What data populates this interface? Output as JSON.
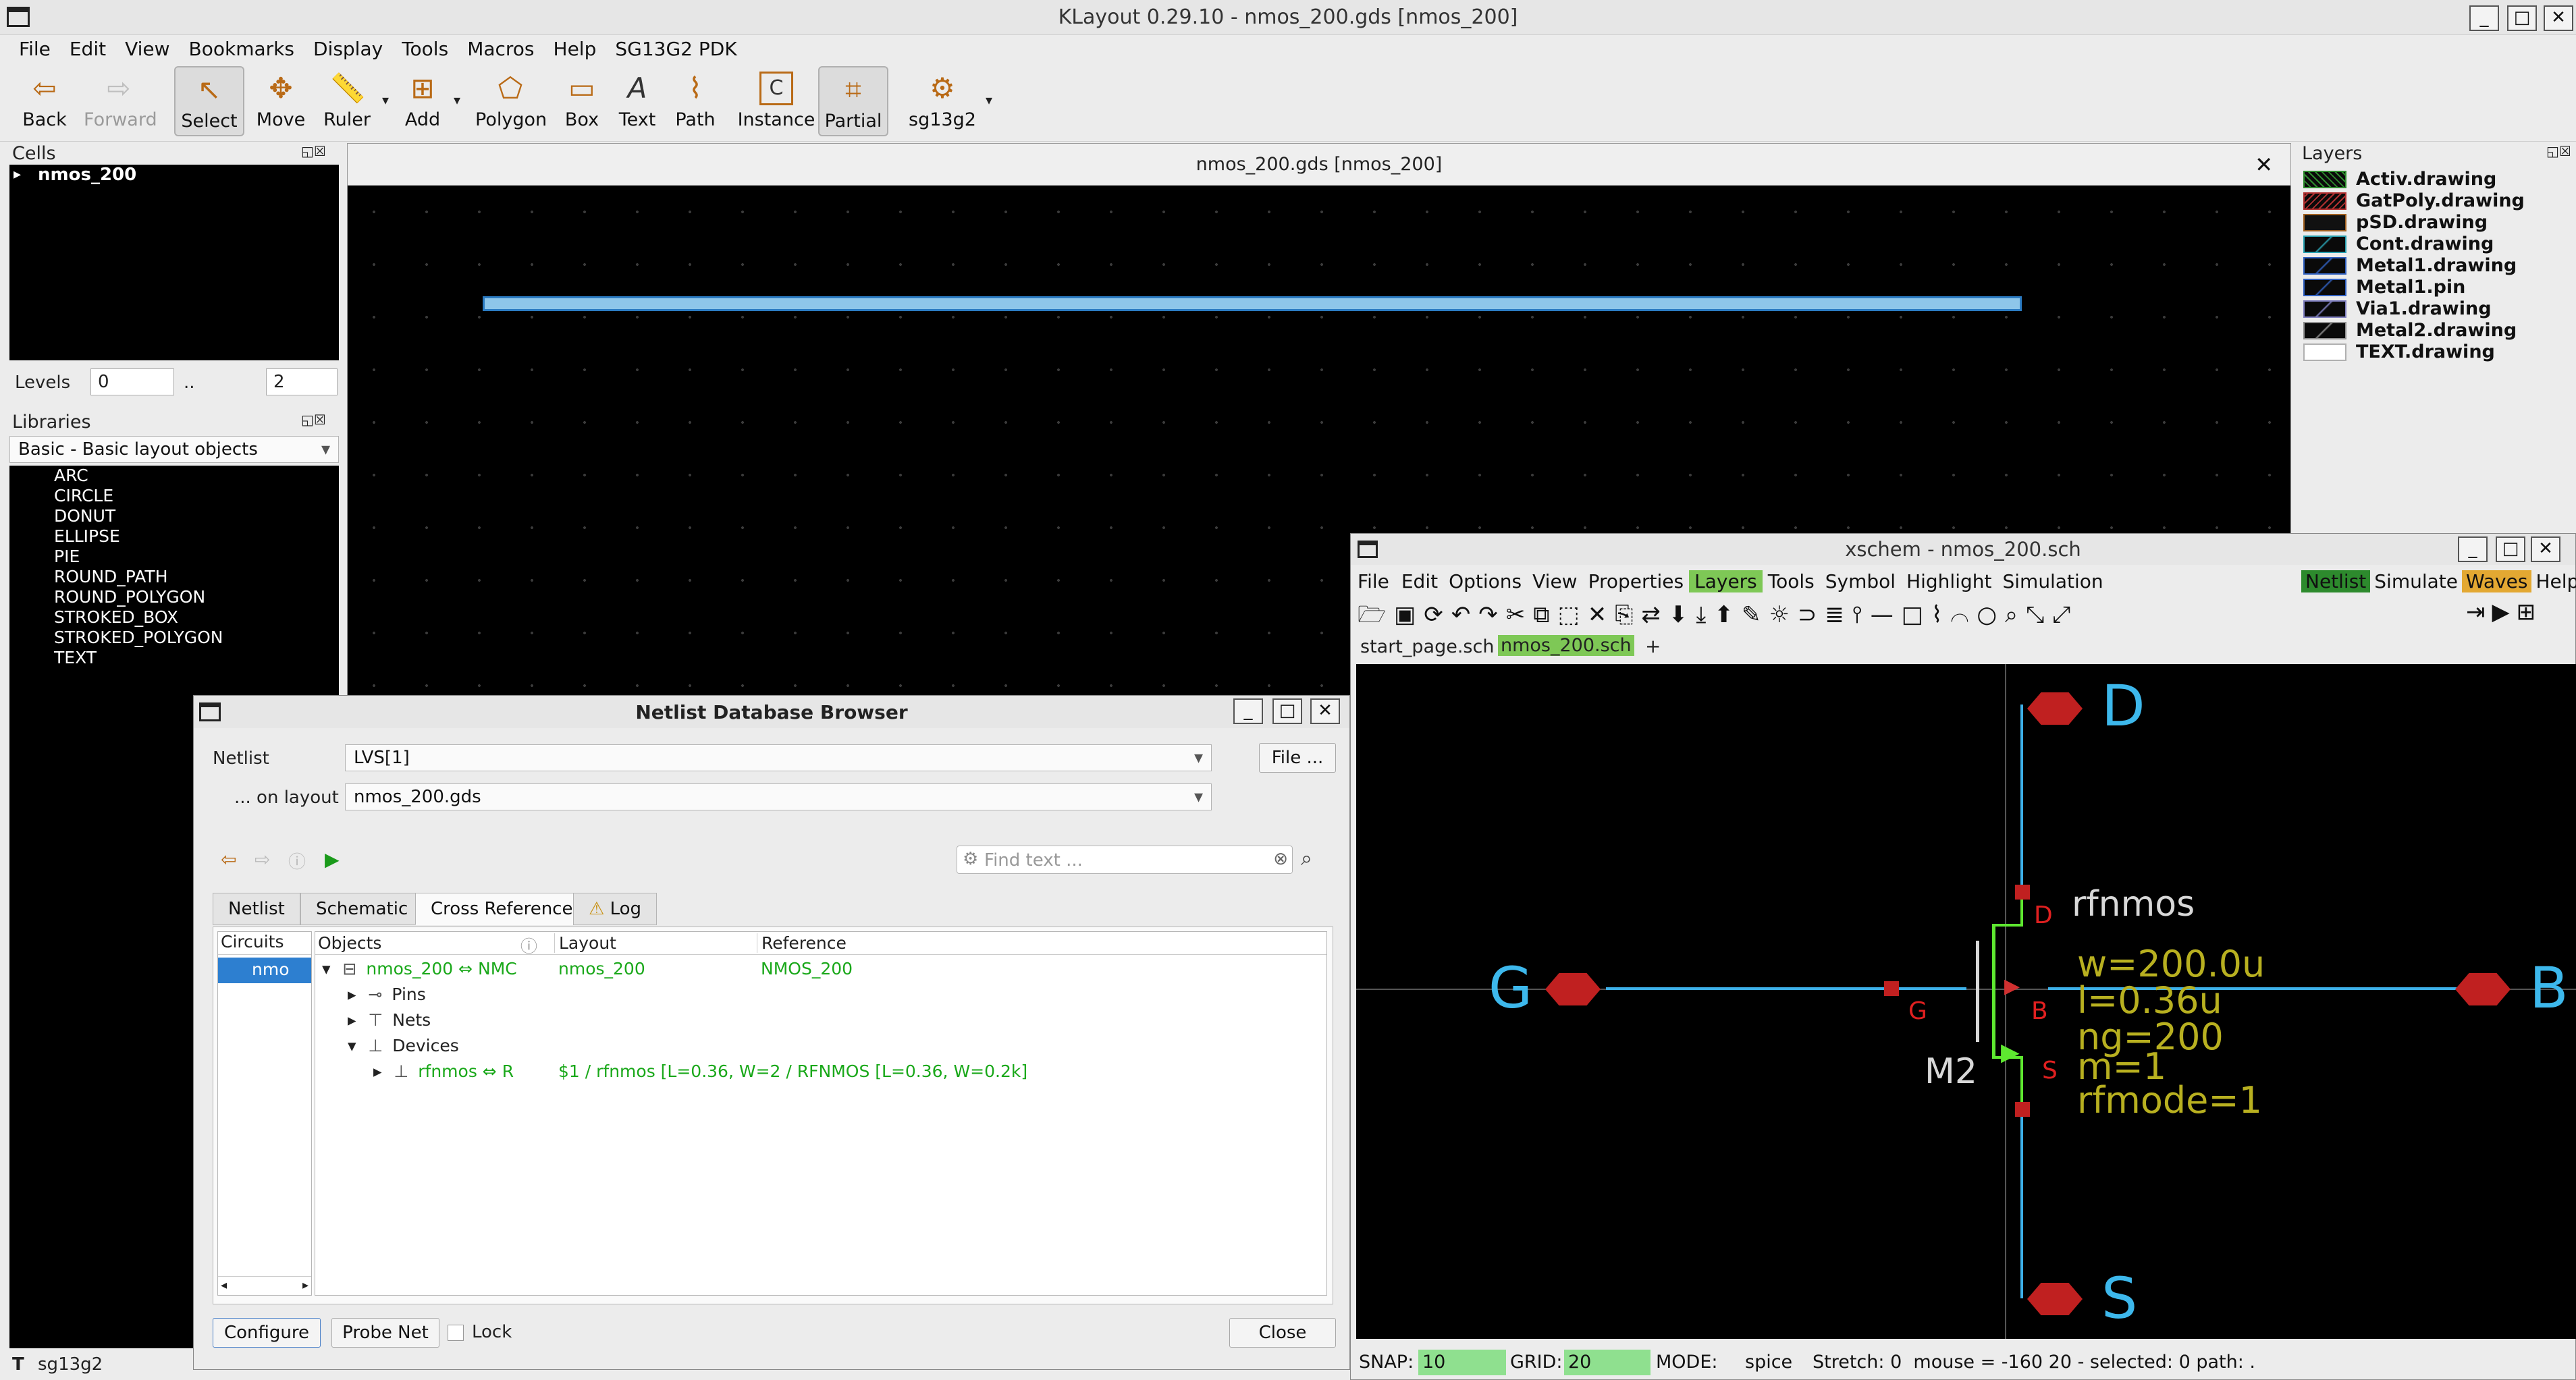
{
  "window": {
    "title": "KLayout 0.29.10 - nmos_200.gds [nmos_200]"
  },
  "menu": [
    "File",
    "Edit",
    "View",
    "Bookmarks",
    "Display",
    "Tools",
    "Macros",
    "Help",
    "SG13G2 PDK"
  ],
  "toolbar": {
    "back": "Back",
    "forward": "Forward",
    "select": "Select",
    "move": "Move",
    "ruler": "Ruler",
    "add": "Add",
    "polygon": "Polygon",
    "box": "Box",
    "text": "Text",
    "path": "Path",
    "instance": "Instance",
    "partial": "Partial",
    "pdk": "sg13g2"
  },
  "cells": {
    "title": "Cells",
    "root": "nmos_200"
  },
  "levels": {
    "label": "Levels",
    "from": "0",
    "sep": "..",
    "to": "2"
  },
  "libraries": {
    "title": "Libraries",
    "selected": "Basic - Basic layout objects",
    "items": [
      "ARC",
      "CIRCLE",
      "DONUT",
      "ELLIPSE",
      "PIE",
      "ROUND_PATH",
      "ROUND_POLYGON",
      "STROKED_BOX",
      "STROKED_POLYGON",
      "TEXT"
    ]
  },
  "layoutview": {
    "tab_title": "nmos_200.gds [nmos_200]"
  },
  "layers": {
    "title": "Layers",
    "items": [
      "Activ.drawing",
      "GatPoly.drawing",
      "pSD.drawing",
      "Cont.drawing",
      "Metal1.drawing",
      "Metal1.pin",
      "Via1.drawing",
      "Metal2.drawing",
      "TEXT.drawing"
    ]
  },
  "xschem": {
    "title": "xschem - nmos_200.sch",
    "menu": [
      "File",
      "Edit",
      "Options",
      "View",
      "Properties",
      "Layers",
      "Tools",
      "Symbol",
      "Highlight",
      "Simulation"
    ],
    "right_menu": [
      "Netlist",
      "Simulate",
      "Waves",
      "Help"
    ],
    "tabs": [
      "start_page.sch",
      "nmos_200.sch",
      "+"
    ],
    "schematic": {
      "pin_d": "D",
      "pin_g": "G",
      "pin_b": "B",
      "pin_s": "S",
      "dev_name": "rfnmos",
      "inst": "M2",
      "term_d": "D",
      "term_g": "G",
      "term_b": "B",
      "term_s": "S",
      "params": [
        "w=200.0u",
        "l=0.36u",
        "ng=200",
        "m=1",
        "rfmode=1"
      ]
    },
    "status": {
      "snap_label": "SNAP:",
      "snap": "10",
      "grid_label": "GRID:",
      "grid": "20",
      "mode_label": "MODE:",
      "mode": "spice",
      "rest": "Stretch: 0  mouse = -160 20 - selected: 0 path: ."
    }
  },
  "netlist_browser": {
    "title": "Netlist Database Browser",
    "netlist_label": "Netlist",
    "netlist_value": "LVS[1]",
    "file_btn": "File ...",
    "layout_label": "... on layout",
    "layout_value": "nmos_200.gds",
    "find_placeholder": "Find text ...",
    "tabs": [
      "Netlist",
      "Schematic",
      "Cross Reference",
      "Log"
    ],
    "circuits_header": "Circuits",
    "circuits_item": "nmo",
    "columns": [
      "Objects",
      "Layout",
      "Reference"
    ],
    "rows": {
      "top_obj": "nmos_200 ⇔ NMC",
      "top_layout": "nmos_200",
      "top_ref": "NMOS_200",
      "pins": "Pins",
      "nets": "Nets",
      "devices": "Devices",
      "dev_obj": "rfnmos ⇔ R",
      "dev_detail": "$1 / rfnmos [L=0.36, W=2 / RFNMOS [L=0.36, W=0.2k]"
    },
    "buttons": {
      "configure": "Configure",
      "probe": "Probe Net",
      "lock": "Lock",
      "close": "Close"
    }
  },
  "status_left": "sg13g2"
}
